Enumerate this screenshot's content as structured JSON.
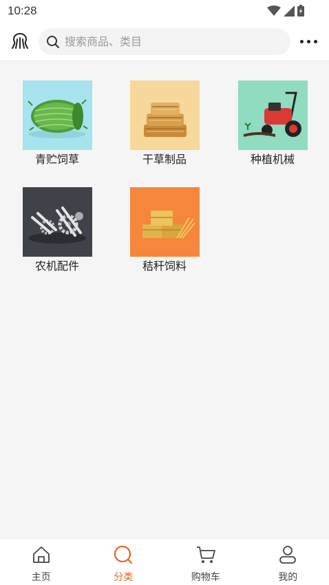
{
  "status_bar": {
    "time": "10:28"
  },
  "header": {
    "search": {
      "placeholder": "搜索商品、类目"
    }
  },
  "categories": [
    {
      "label": "青贮饲草",
      "icon": "silage-grass-bale-image",
      "bg": "#a6e3ee"
    },
    {
      "label": "干草制品",
      "icon": "hay-bundles-image",
      "bg": "#f6d89a"
    },
    {
      "label": "种植机械",
      "icon": "red-tiller-machine-image",
      "bg": "#8fdcc0"
    },
    {
      "label": "农机配件",
      "icon": "machine-parts-image",
      "bg": "#3f4349"
    },
    {
      "label": "秸秆饲料",
      "icon": "straw-bales-image",
      "bg": "#f5863c"
    }
  ],
  "tab_bar": {
    "tabs": [
      {
        "label": "主页",
        "icon": "home-icon",
        "active": false
      },
      {
        "label": "分类",
        "icon": "category-search-icon",
        "active": true
      },
      {
        "label": "购物车",
        "icon": "cart-icon",
        "active": false
      },
      {
        "label": "我的",
        "icon": "user-icon",
        "active": false
      }
    ],
    "active_color": "#e8631c"
  }
}
